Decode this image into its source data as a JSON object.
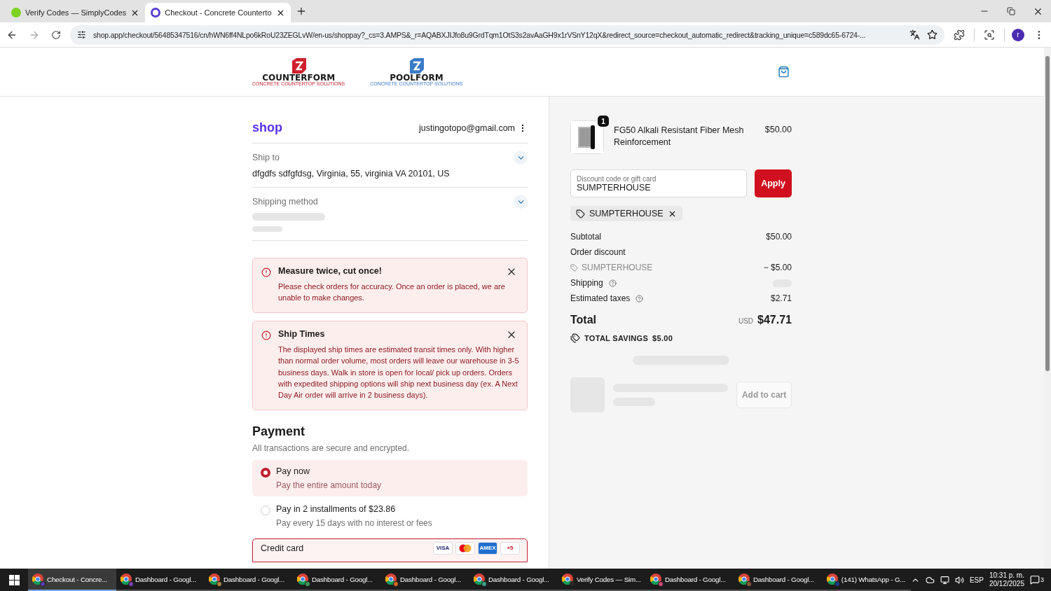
{
  "browser": {
    "tabs": [
      {
        "title": "Verify Codes — SimplyCodes",
        "selected": false
      },
      {
        "title": "Checkout - Concrete Counterto",
        "selected": true
      }
    ],
    "url": "shop.app/checkout/56485347516/cn/hWN6ff4NLpo6kRoU23ZEGLvW/en-us/shoppay?_cs=3.AMPS&_r=AQABXJIJfo8u9GrdTqm1OtS3s2avAaGH9x1rVSnY12qX&redirect_source=checkout_automatic_redirect&tracking_unique=c589dc65-6724-...",
    "profile": "r"
  },
  "header": {
    "logos": [
      {
        "name": "COUNTERFORM",
        "tagline": "CONCRETE COUNTERTOP SOLUTIONS",
        "color": "#d0202e"
      },
      {
        "name": "POOLFORM",
        "tagline": "CONCRETE COUNTERTOP SOLUTIONS",
        "color": "#3a7bc8"
      }
    ]
  },
  "account": {
    "brand": "shop",
    "email": "justingotopo@gmail.com"
  },
  "sections": [
    {
      "label": "Ship to",
      "value": "dfgdfs sdfgfdsg, Virginia, 55, virginia VA 20101, US",
      "loading": false
    },
    {
      "label": "Shipping method",
      "loading": true
    }
  ],
  "notices": [
    {
      "title": "Measure twice, cut once!",
      "body": "Please check orders for accuracy. Once an order is placed, we are unable to make changes."
    },
    {
      "title": "Ship Times",
      "body": "The displayed ship times are estimated transit times only. With higher than normal order volume, most orders will leave our warehouse in 3-5 business days. Walk in store is open for local/ pick up orders. Orders with expedited shipping options will ship next business day (ex. A Next Day Air order will arrive in 2 business days)."
    }
  ],
  "payment": {
    "title": "Payment",
    "subtitle": "All transactions are secure and encrypted.",
    "options": [
      {
        "label": "Pay now",
        "detail": "Pay the entire amount today",
        "selected": true
      },
      {
        "label": "Pay in 2 installments of $23.86",
        "detail": "Pay every 15 days with no interest or fees",
        "selected": false
      }
    ],
    "method": {
      "label": "Credit card",
      "cards": [
        {
          "kind": "visa",
          "text": "VISA"
        },
        {
          "kind": "mastercard"
        },
        {
          "kind": "amex",
          "text": "AMEX"
        },
        {
          "kind": "more",
          "text": "+5"
        }
      ]
    }
  },
  "summary": {
    "item": {
      "name": "FG50 Alkali Resistant Fiber Mesh Reinforcement",
      "price": "$50.00",
      "quantity": "1"
    },
    "discount": {
      "label": "Discount code or gift card",
      "value": "SUMPTERHOUSE",
      "button": "Apply"
    },
    "applied_code": "SUMPTERHOUSE",
    "lines": [
      {
        "kind": "plain",
        "label": "Subtotal",
        "value": "$50.00"
      },
      {
        "kind": "heading",
        "label": "Order discount"
      },
      {
        "kind": "code",
        "label": "SUMPTERHOUSE",
        "value": "− $5.00"
      },
      {
        "kind": "help",
        "label": "Shipping",
        "loading": true
      },
      {
        "kind": "help",
        "label": "Estimated taxes",
        "value": "$2.71",
        "loading": false
      }
    ],
    "total": {
      "label": "Total",
      "currency": "USD",
      "value": "$47.71"
    },
    "savings": {
      "label": "TOTAL SAVINGS",
      "value": "$5.00"
    },
    "upsell": {
      "button": "Add to cart"
    }
  },
  "taskbar": {
    "items": [
      {
        "label": "Checkout - Concre...",
        "selected": true,
        "color": "#5b3fb0"
      },
      {
        "label": "Dashboard - Googl...",
        "selected": false,
        "color": "#7a3fb0"
      },
      {
        "label": "Dashboard - Googl...",
        "selected": false,
        "color": "#b0853f"
      },
      {
        "label": "Dashboard - Googl...",
        "selected": false,
        "color": "#3f9b5a"
      },
      {
        "label": "Dashboard - Googl...",
        "selected": false,
        "color": "#d86a2a"
      },
      {
        "label": "Dashboard - Googl...",
        "selected": false,
        "color": "#3fa08a"
      },
      {
        "label": "Verify Codes — Sim...",
        "selected": false,
        "color": "#2a2a2a"
      },
      {
        "label": "Dashboard - Googl...",
        "selected": false,
        "color": "#d04a7a"
      },
      {
        "label": "Dashboard - Googl...",
        "selected": false,
        "color": "#8a5a3a"
      },
      {
        "label": "(141) WhatsApp - G...",
        "selected": false,
        "color": "#1e3a8a"
      }
    ],
    "language": "ESP",
    "time": "10:31 p. m.",
    "date": "20/12/2025",
    "notifications": "3"
  }
}
